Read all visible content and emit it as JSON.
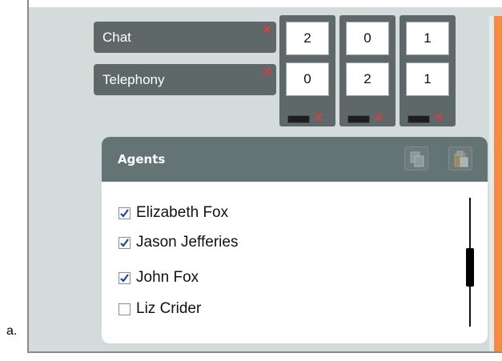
{
  "figure_label": "a.",
  "channels": [
    {
      "label": "Chat"
    },
    {
      "label": "Telephony"
    }
  ],
  "skill_columns": [
    {
      "values": [
        "2",
        "0"
      ]
    },
    {
      "values": [
        "0",
        "2"
      ]
    },
    {
      "values": [
        "1",
        "1"
      ]
    }
  ],
  "agents_panel": {
    "title": "Agents",
    "agents": [
      {
        "name": "Elizabeth Fox",
        "checked": true
      },
      {
        "name": "Jason Jefferies",
        "checked": true
      },
      {
        "name": "John Fox",
        "checked": true
      },
      {
        "name": "Liz Crider",
        "checked": false
      }
    ]
  },
  "icons": {
    "channel_remove": "close-icon",
    "column_remove": "close-icon",
    "copy": "copy-icon",
    "paste": "paste-icon",
    "checkbox": "checkmark-icon"
  },
  "colors": {
    "accent_orange": "#f58a40",
    "delete_red": "#e13b3b",
    "header_slate": "#647474",
    "tile_dark": "#5f6868",
    "background": "#d3dbdb"
  }
}
